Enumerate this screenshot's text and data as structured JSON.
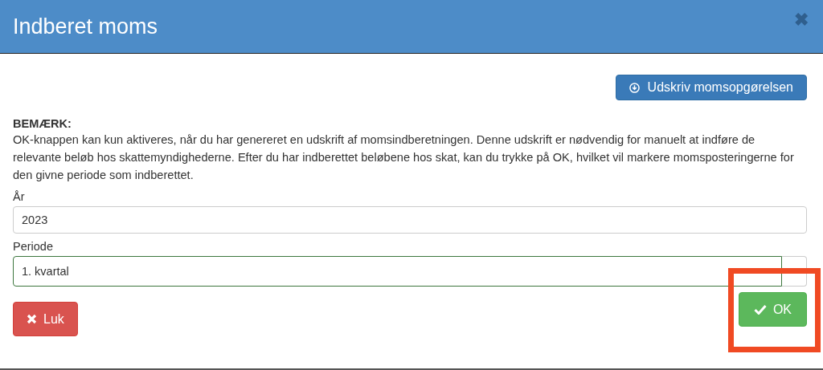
{
  "dialog": {
    "title": "Indberet moms",
    "close_icon": "✖"
  },
  "print_button": {
    "label": "Udskriv momsopgørelsen"
  },
  "notice": {
    "heading": "BEMÆRK:",
    "text": "OK-knappen kan kun aktiveres, når du har genereret en udskrift af momsindberetningen. Denne udskrift er nødvendig for manuelt at indføre de relevante beløb hos skattemyndighederne. Efter du har indberettet beløbene hos skat, kan du trykke på OK, hvilket vil markere momsposteringerne for den givne periode som indberettet."
  },
  "fields": [
    {
      "label": "År",
      "value": "2023",
      "valid": false,
      "kind": "text"
    },
    {
      "label": "Periode",
      "value": "1. kvartal",
      "valid": true,
      "kind": "addon"
    }
  ],
  "buttons": [
    {
      "label": "Luk",
      "kind": "close",
      "highlighted": false
    },
    {
      "label": "OK",
      "kind": "ok",
      "highlighted": true
    }
  ]
}
